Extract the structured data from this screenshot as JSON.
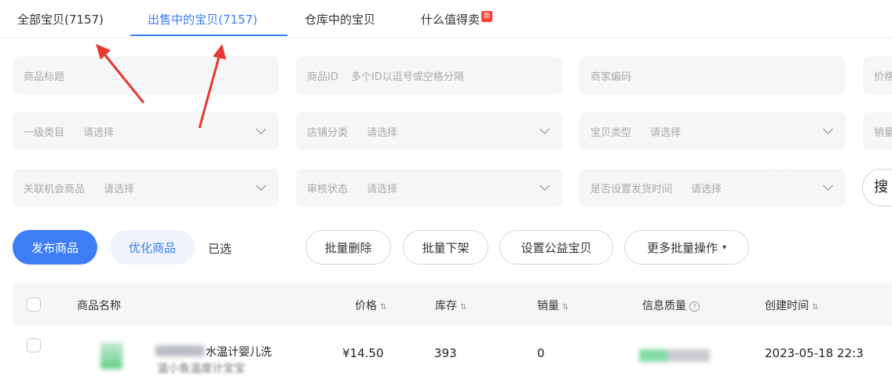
{
  "tabs": {
    "all": "全部宝贝(7157)",
    "on_sale": "出售中的宝贝(7157)",
    "warehouse": "仓库中的宝贝",
    "worth_selling": "什么值得卖",
    "new_badge": "新"
  },
  "filters": {
    "title_label": "商品标题",
    "id_label": "商品ID",
    "id_placeholder": "多个ID以逗号或空格分隔",
    "code_label": "商家编码",
    "price_label": "价格",
    "category_label": "一级类目",
    "category_value": "请选择",
    "shop_cat_label": "店铺分类",
    "shop_cat_value": "请选择",
    "type_label": "宝贝类型",
    "type_value": "请选择",
    "sales_label": "销量",
    "opportunity_label": "关联机会商品",
    "opportunity_value": "请选择",
    "audit_label": "审核状态",
    "audit_value": "请选择",
    "ship_time_label": "是否设置发货时间",
    "ship_time_value": "请选择",
    "search_label": "搜"
  },
  "watermark": "公众号:查心号",
  "actions": {
    "publish": "发布商品",
    "optimize": "优化商品",
    "selected": "已选",
    "batch_delete": "批量删除",
    "batch_offline": "批量下架",
    "set_charity": "设置公益宝贝",
    "more_batch": "更多批量操作"
  },
  "table": {
    "headers": {
      "name": "商品名称",
      "price": "价格",
      "stock": "库存",
      "sales": "销量",
      "quality": "信息质量",
      "created": "创建时间"
    },
    "rows": [
      {
        "name": "水温计婴儿洗",
        "name_line2": "温小鱼温度计宝宝",
        "price": "¥14.50",
        "stock": "393",
        "sales": "0",
        "created": "2023-05-18 22:3"
      }
    ]
  },
  "colors": {
    "accent": "#3d7ef6",
    "arrow": "#e8382f"
  }
}
